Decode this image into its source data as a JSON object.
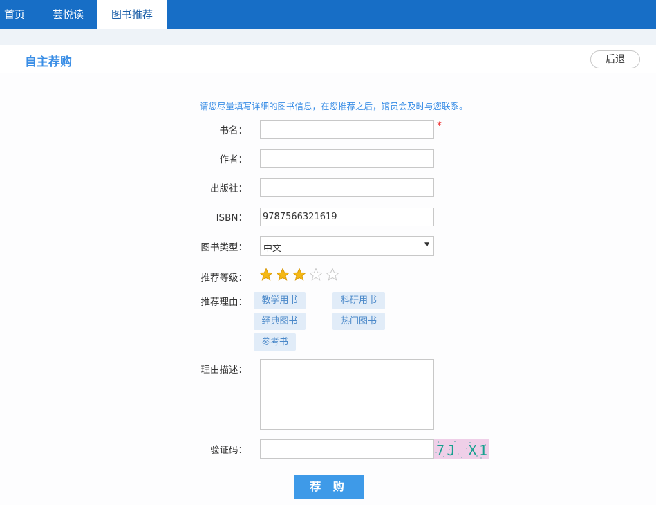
{
  "nav": {
    "tabs": [
      {
        "label": "首页"
      },
      {
        "label": "芸悦读"
      },
      {
        "label": "图书推荐"
      }
    ]
  },
  "header": {
    "title": "自主荐购",
    "back_label": "后退"
  },
  "form": {
    "notice": "请您尽量填写详细的图书信息，在您推荐之后，馆员会及时与您联系。",
    "required_mark": "*",
    "labels": {
      "title": "书名：",
      "author": "作者：",
      "publisher": "出版社：",
      "isbn": "ISBN：",
      "book_type": "图书类型：",
      "rating": "推荐等级：",
      "reason": "推荐理由：",
      "description": "理由描述：",
      "captcha": "验证码："
    },
    "values": {
      "title": "",
      "author": "",
      "publisher": "",
      "isbn": "9787566321619",
      "book_type": "中文",
      "description": "",
      "captcha": ""
    },
    "rating": {
      "value": 3,
      "max": 5
    },
    "reason_tags": [
      "教学用书",
      "科研用书",
      "经典图书",
      "热门图书",
      "参考书"
    ],
    "captcha_image_text": "7J X1",
    "submit_label": "荐 购"
  },
  "colors": {
    "nav_bg": "#176ec6",
    "accent": "#3a8ee6",
    "star_filled": "#f5b814",
    "tag_bg": "#e1ecf8"
  }
}
